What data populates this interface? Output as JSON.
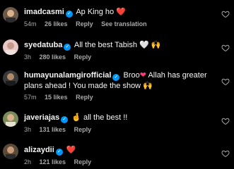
{
  "comments": [
    {
      "username": "imadcasmi",
      "verified": true,
      "text": "Ap King ho",
      "emoji": "❤️",
      "time": "54m",
      "likes": "26 likes",
      "reply": "Reply",
      "extra": "See translation"
    },
    {
      "username": "syedatuba",
      "verified": true,
      "text": "All the best Tabish",
      "emoji": "🤍 🙌",
      "time": "3h",
      "likes": "280 likes",
      "reply": "Reply"
    },
    {
      "username": "humayunalamgirofficial",
      "verified": true,
      "text_pre": "Broo",
      "text": "Allah has greater plans ahead ! You made the show",
      "emoji": "🙌",
      "time": "57m",
      "likes": "15 likes",
      "reply": "Reply"
    },
    {
      "username": "javeriajas",
      "verified": true,
      "emoji": "🤞",
      "text": "all the best !!",
      "time": "3h",
      "likes": "131 likes",
      "reply": "Reply"
    },
    {
      "username": "alizaydii",
      "verified": true,
      "emoji": "❤️",
      "time": "2h",
      "likes": "121 likes",
      "reply": "Reply"
    }
  ],
  "colors": {
    "background": "#000000",
    "verified": "#0095f6",
    "meta": "#a8a8a8"
  }
}
